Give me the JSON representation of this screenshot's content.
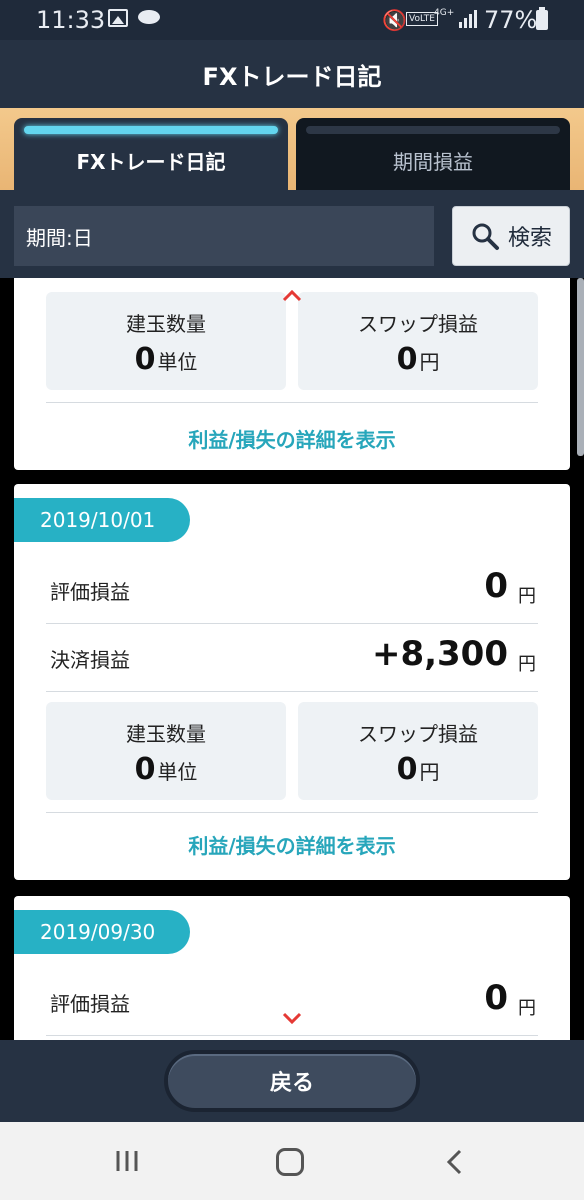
{
  "status_bar": {
    "time": "11:33",
    "volte": "VoLTE",
    "network": "4G+",
    "battery": "77%"
  },
  "header": {
    "title": "FXトレード日記"
  },
  "tabs": [
    {
      "label": "FXトレード日記",
      "active": true
    },
    {
      "label": "期間損益",
      "active": false
    }
  ],
  "search": {
    "period": "期間:日",
    "button_label": "検索"
  },
  "cards": [
    {
      "boxes": [
        {
          "label": "建玉数量",
          "value": "0",
          "unit": "単位"
        },
        {
          "label": "スワップ損益",
          "value": "0",
          "unit": "円"
        }
      ],
      "detail_link": "利益/損失の詳細を表示"
    },
    {
      "date": "2019/10/01",
      "rows": [
        {
          "label": "評価損益",
          "value": "0",
          "unit": "円"
        },
        {
          "label": "決済損益",
          "value": "+8,300",
          "unit": "円"
        }
      ],
      "boxes": [
        {
          "label": "建玉数量",
          "value": "0",
          "unit": "単位"
        },
        {
          "label": "スワップ損益",
          "value": "0",
          "unit": "円"
        }
      ],
      "detail_link": "利益/損失の詳細を表示"
    },
    {
      "date": "2019/09/30",
      "rows": [
        {
          "label": "評価損益",
          "value": "0",
          "unit": "円"
        }
      ]
    }
  ],
  "footer": {
    "back_label": "戻る"
  },
  "colors": {
    "header_bg": "#263243",
    "accent_teal": "#27b1c5",
    "tab_glow": "#63d6ef",
    "scroll_arrow": "#e53935"
  }
}
